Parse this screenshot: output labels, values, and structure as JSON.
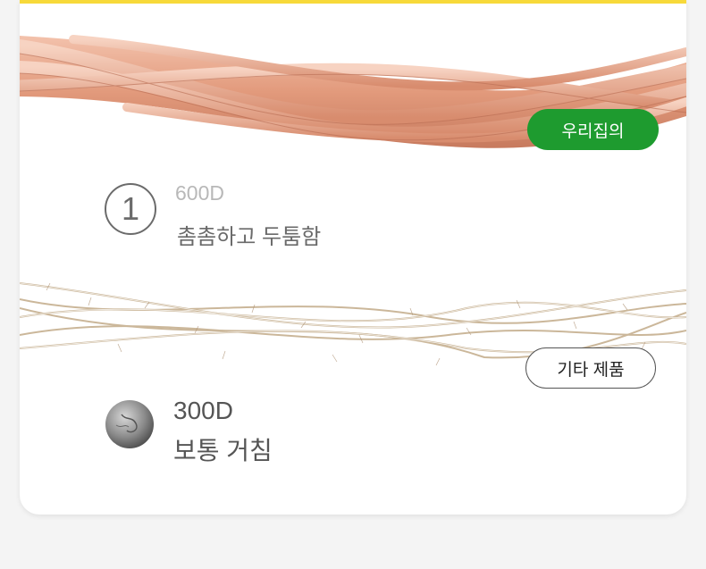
{
  "ours": {
    "badge_label": "우리집의",
    "spec": "600D",
    "description": "촘촘하고 두툼함",
    "number_mark": "1"
  },
  "other": {
    "badge_label": "기타 제품",
    "spec": "300D",
    "description": "보통 거침"
  },
  "colors": {
    "accent_bar": "#f7d93a",
    "ours_badge": "#1e9b2f",
    "copper": "#e8a488",
    "thin_fiber": "#cbb79a"
  }
}
